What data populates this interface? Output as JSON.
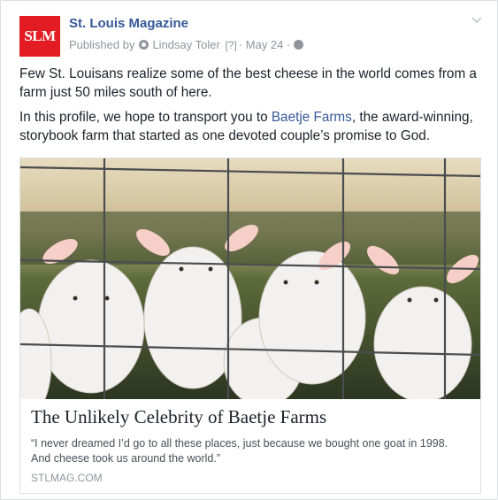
{
  "post": {
    "page_name": "St. Louis Magazine",
    "logo_text": "SLM",
    "meta": {
      "published_by_label": "Published by",
      "author": "Lindsay Toler",
      "help_marker": "[?]",
      "separator": "·",
      "date": "May 24",
      "separator2": "·"
    },
    "body": {
      "paragraph1": "Few St. Louisans realize some of the best cheese in the world comes from a farm just 50 miles south of here.",
      "paragraph2_before": "In this profile, we hope to transport you to ",
      "paragraph2_link": "Baetje Farms",
      "paragraph2_after": ", the award-winning, storybook farm that started as one devoted couple’s promise to God."
    },
    "card": {
      "title": "The Unlikely Celebrity of Baetje Farms",
      "description": "“I never dreamed I’d go to all these places, just because we bought one goat in 1998. And cheese took us around the world.”",
      "domain": "STLMAG.COM",
      "image_subject": "white baby goats behind a wire fence"
    }
  },
  "colors": {
    "brand_red": "#e31b23",
    "link_blue": "#365899",
    "meta_gray": "#90949c",
    "text": "#1d2129"
  }
}
